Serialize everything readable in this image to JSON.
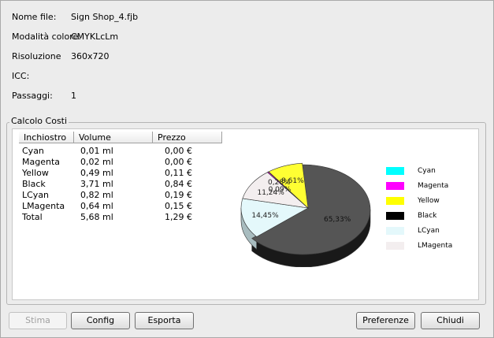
{
  "info": {
    "file_label": "Nome file:",
    "file_value": "Sign Shop_4.fjb",
    "color_label": "Modalità colore:",
    "color_value": "CMYKLcLm",
    "res_label": "Risoluzione",
    "res_value": "360x720",
    "icc_label": "ICC:",
    "icc_value": "",
    "pass_label": "Passaggi:",
    "pass_value": "1"
  },
  "cost_group": {
    "title": "Calcolo Costi",
    "headers": [
      "Inchiostro",
      "Volume",
      "Prezzo"
    ],
    "rows": [
      [
        "Cyan",
        "0,01 ml",
        "0,00 €"
      ],
      [
        "Magenta",
        "0,02 ml",
        "0,00 €"
      ],
      [
        "Yellow",
        "0,49 ml",
        "0,11 €"
      ],
      [
        "Black",
        "3,71 ml",
        "0,84 €"
      ],
      [
        "LCyan",
        "0,82 ml",
        "0,19 €"
      ],
      [
        "LMagenta",
        "0,64 ml",
        "0,15 €"
      ],
      [
        "Total",
        "5,68 ml",
        "1,29 €"
      ]
    ]
  },
  "chart_data": {
    "type": "pie",
    "slices": [
      {
        "name": "Black",
        "value": 65.33,
        "label": "65,33%",
        "color": "#555555"
      },
      {
        "name": "LCyan",
        "value": 14.45,
        "label": "14,45%",
        "color": "#e4f8fb"
      },
      {
        "name": "LMagenta",
        "value": 11.24,
        "label": "11,24%",
        "color": "#f3eeef"
      },
      {
        "name": "Magenta",
        "value": 0.28,
        "label": "0,28%",
        "color": "#ff00ff"
      },
      {
        "name": "Cyan",
        "value": 0.09,
        "label": "0,09%",
        "color": "#00ffff"
      },
      {
        "name": "Yellow",
        "value": 8.61,
        "label": "8,61%",
        "color": "#ffff33"
      }
    ],
    "legend": [
      {
        "name": "Cyan",
        "color": "#00ffff"
      },
      {
        "name": "Magenta",
        "color": "#ff00ff"
      },
      {
        "name": "Yellow",
        "color": "#ffff00"
      },
      {
        "name": "Black",
        "color": "#000000"
      },
      {
        "name": "LCyan",
        "color": "#e4f8fb"
      },
      {
        "name": "LMagenta",
        "color": "#f3eeef"
      }
    ],
    "legend_position": "right"
  },
  "buttons": {
    "stima": "Stima",
    "config": "Config",
    "esporta": "Esporta",
    "preferenze": "Preferenze",
    "chiudi": "Chiudi"
  }
}
